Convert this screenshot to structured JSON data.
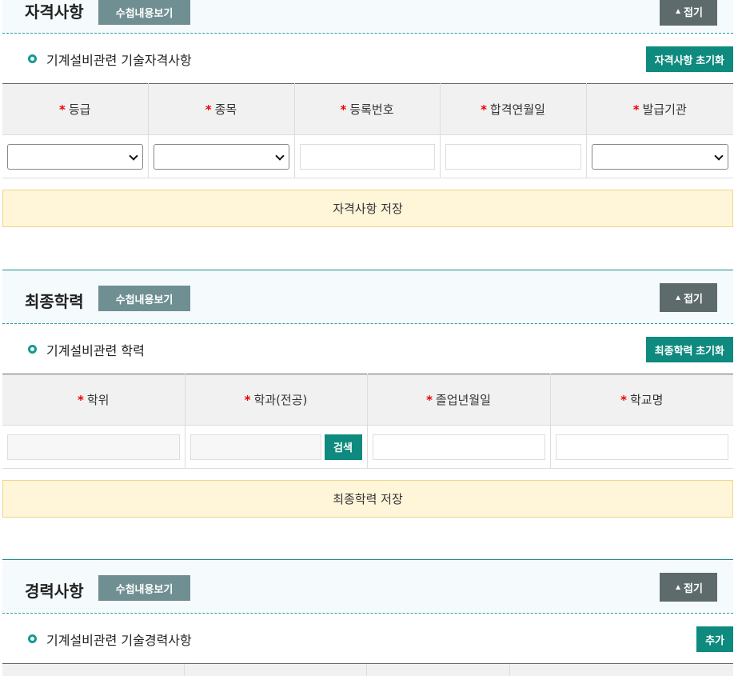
{
  "sections": [
    {
      "title": "자격사항",
      "view_label": "수첩내용보기",
      "fold_label": "접기",
      "subtitle": "기계설비관련 기술자격사항",
      "reset_label": "자격사항 초기화",
      "columns": [
        "등급",
        "종목",
        "등록번호",
        "합격연월일",
        "발급기관"
      ],
      "save_label": "자격사항 저장"
    },
    {
      "title": "최종학력",
      "view_label": "수첩내용보기",
      "fold_label": "접기",
      "subtitle": "기계설비관련 학력",
      "reset_label": "최종학력 초기화",
      "columns": [
        "학위",
        "학과(전공)",
        "졸업년월일",
        "학교명"
      ],
      "search_label": "검색",
      "save_label": "최종학력 저장"
    },
    {
      "title": "경력사항",
      "view_label": "수첩내용보기",
      "fold_label": "접기",
      "subtitle": "기계설비관련 기술경력사항",
      "add_label": "추가"
    }
  ],
  "icons": {
    "required": "*",
    "fold": "▲",
    "bullet": "circle-bullet-icon"
  },
  "colors": {
    "accent": "#0e8a7e",
    "required": "#ee0000",
    "save_bar": "#fff5d9"
  }
}
